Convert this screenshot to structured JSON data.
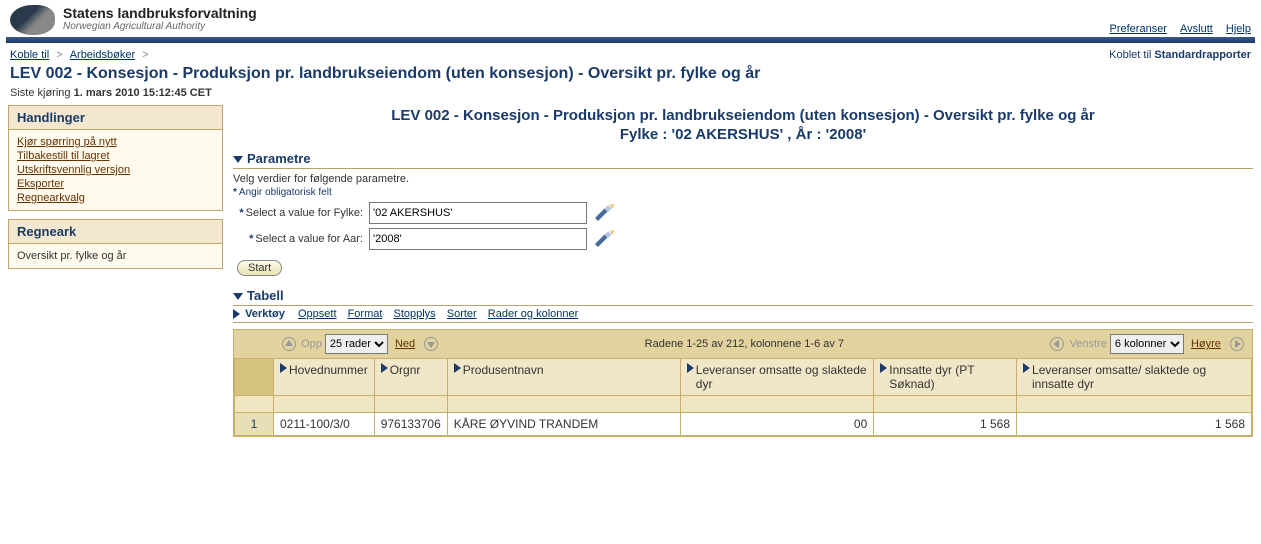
{
  "brand": {
    "title": "Statens landbruksforvaltning",
    "subtitle": "Norwegian Agricultural Authority"
  },
  "header_links": {
    "prefs": "Preferanser",
    "logout": "Avslutt",
    "help": "Hjelp"
  },
  "crumbs": {
    "link1": "Koble til",
    "link2": "Arbeidsbøker",
    "connected_label": "Koblet til",
    "connected_value": "Standardrapporter"
  },
  "page_title": "LEV 002 - Konsesjon - Produksjon pr. landbrukseiendom (uten konsesjon) - Oversikt pr. fylke og år",
  "last_run": {
    "label": "Siste kjøring",
    "value": "1. mars 2010 15:12:45 CET"
  },
  "sidebar": {
    "handlinger": {
      "title": "Handlinger",
      "items": [
        "Kjør spørring på nytt",
        "Tilbakestill til lagret",
        "Utskriftsvennlig versjon",
        "Eksporter",
        "Regnearkvalg"
      ]
    },
    "regneark": {
      "title": "Regneark",
      "items": [
        "Oversikt pr. fylke og år"
      ]
    }
  },
  "report": {
    "title_line1": "LEV 002 - Konsesjon - Produksjon pr. landbrukseiendom (uten konsesjon) - Oversikt pr. fylke og år",
    "title_line2": "Fylke : '02 AKERSHUS' , År : '2008'"
  },
  "params": {
    "section": "Parametre",
    "hint": "Velg verdier for følgende parametre.",
    "required_note": "Angir obligatorisk felt",
    "p1_label": "Select a value for Fylke:",
    "p1_value": "'02 AKERSHUS'",
    "p2_label": "Select a value for Aar:",
    "p2_value": "'2008'",
    "start": "Start"
  },
  "tabell_section": "Tabell",
  "toolbar": {
    "label": "Verktøy",
    "oppsett": "Oppsett",
    "format": "Format",
    "stopplys": "Stopplys",
    "sorter": "Sorter",
    "rader": "Rader og kolonner"
  },
  "pager": {
    "up": "Opp",
    "rows_select": "25 rader",
    "down": "Ned",
    "center": "Radene 1-25 av 212, kolonnene 1-6 av 7",
    "left": "Venstre",
    "cols_select": "6 kolonner",
    "right": "Høyre"
  },
  "grid": {
    "headers": [
      "Hovednummer",
      "Orgnr",
      "Produsentnavn",
      "Leveranser omsatte og slaktede dyr",
      "Innsatte dyr (PT Søknad)",
      "Leveranser omsatte/ slaktede og innsatte dyr"
    ],
    "rows": [
      {
        "n": "1",
        "hovednummer": "0211-100/3/0",
        "orgnr": "976133706",
        "produsent": "KÅRE ØYVIND TRANDEM",
        "lev_omsatte": "00",
        "innsatte": "1 568",
        "lev_total": "1 568"
      }
    ]
  }
}
